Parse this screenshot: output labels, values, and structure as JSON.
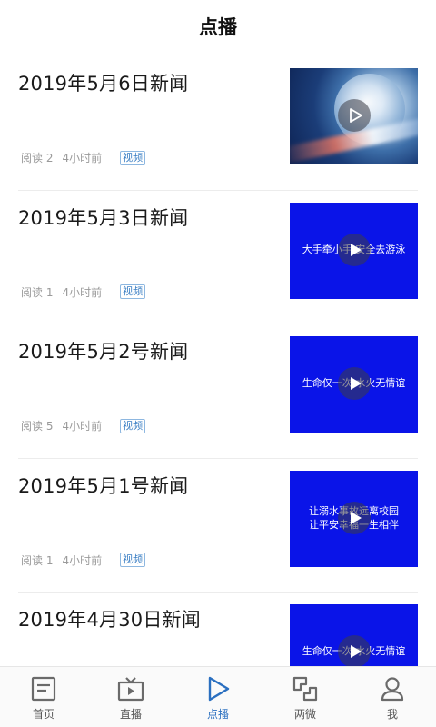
{
  "header": {
    "title": "点播"
  },
  "feed": {
    "items": [
      {
        "title": "2019年5月6日新闻",
        "read": "阅读 2",
        "time": "4小时前",
        "badge": "视频",
        "thumb_caption": ""
      },
      {
        "title": "2019年5月3日新闻",
        "read": "阅读 1",
        "time": "4小时前",
        "badge": "视频",
        "thumb_caption": "大手牵小手 安全去游泳"
      },
      {
        "title": "2019年5月2号新闻",
        "read": "阅读 5",
        "time": "4小时前",
        "badge": "视频",
        "thumb_caption": "生命仅一次 水火无情谊"
      },
      {
        "title": "2019年5月1号新闻",
        "read": "阅读 1",
        "time": "4小时前",
        "badge": "视频",
        "thumb_caption_line1": "让溺水事故远离校园",
        "thumb_caption_line2": "让平安幸福一生相伴"
      },
      {
        "title": "2019年4月30日新闻",
        "read": "",
        "time": "",
        "badge": "",
        "thumb_caption": "生命仅一次 水火无情谊"
      }
    ]
  },
  "tabbar": {
    "tabs": [
      {
        "label": "首页",
        "icon": "news-icon"
      },
      {
        "label": "直播",
        "icon": "tv-icon"
      },
      {
        "label": "点播",
        "icon": "play-icon"
      },
      {
        "label": "两微",
        "icon": "share-squares-icon"
      },
      {
        "label": "我",
        "icon": "user-icon"
      }
    ],
    "active_index": 2
  },
  "colors": {
    "accent": "#2a6fc0",
    "thumb_blue": "#0a14e8",
    "badge": "#3b7fc4",
    "meta_text": "#9a9a9a"
  }
}
